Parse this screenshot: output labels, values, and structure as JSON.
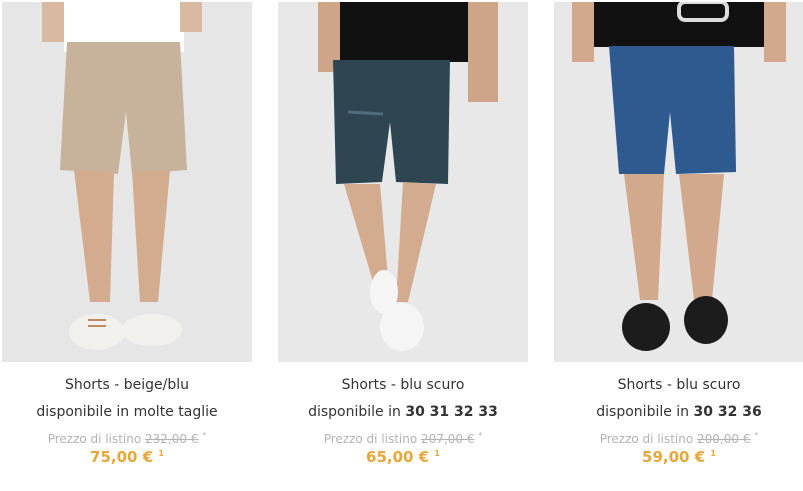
{
  "products": [
    {
      "title": "Shorts - beige/blu",
      "availability": "disponibile in molte taglie",
      "sizes": "",
      "list_label": "Prezzo di listino",
      "list_price": "232,00 €",
      "list_mark": "*",
      "price": "75,00 €",
      "price_mark": "1",
      "image_icon": "beige-shorts-photo",
      "colors": {
        "bg": "#e6e6e6",
        "short": "#c7b39c",
        "shirt": "#ffffff",
        "shoe": "#f2f0ec"
      }
    },
    {
      "title": "Shorts - blu scuro",
      "availability": "disponibile in",
      "sizes": "30 31 32 33",
      "list_label": "Prezzo di listino",
      "list_price": "207,00 €",
      "list_mark": "*",
      "price": "65,00 €",
      "price_mark": "1",
      "image_icon": "dark-denim-shorts-photo",
      "colors": {
        "bg": "#e8e8e8",
        "short": "#2f4652",
        "shirt": "#111111",
        "shoe": "#f5f5f5"
      }
    },
    {
      "title": "Shorts - blu scuro",
      "availability": "disponibile in",
      "sizes": "30 32 36",
      "list_label": "Prezzo di listino",
      "list_price": "200,00 €",
      "list_mark": "*",
      "price": "59,00 €",
      "price_mark": "1",
      "image_icon": "blue-shorts-photo",
      "colors": {
        "bg": "#e8e8e8",
        "short": "#2f5a8f",
        "shirt": "#111111",
        "shoe": "#1c1c1c"
      }
    }
  ]
}
